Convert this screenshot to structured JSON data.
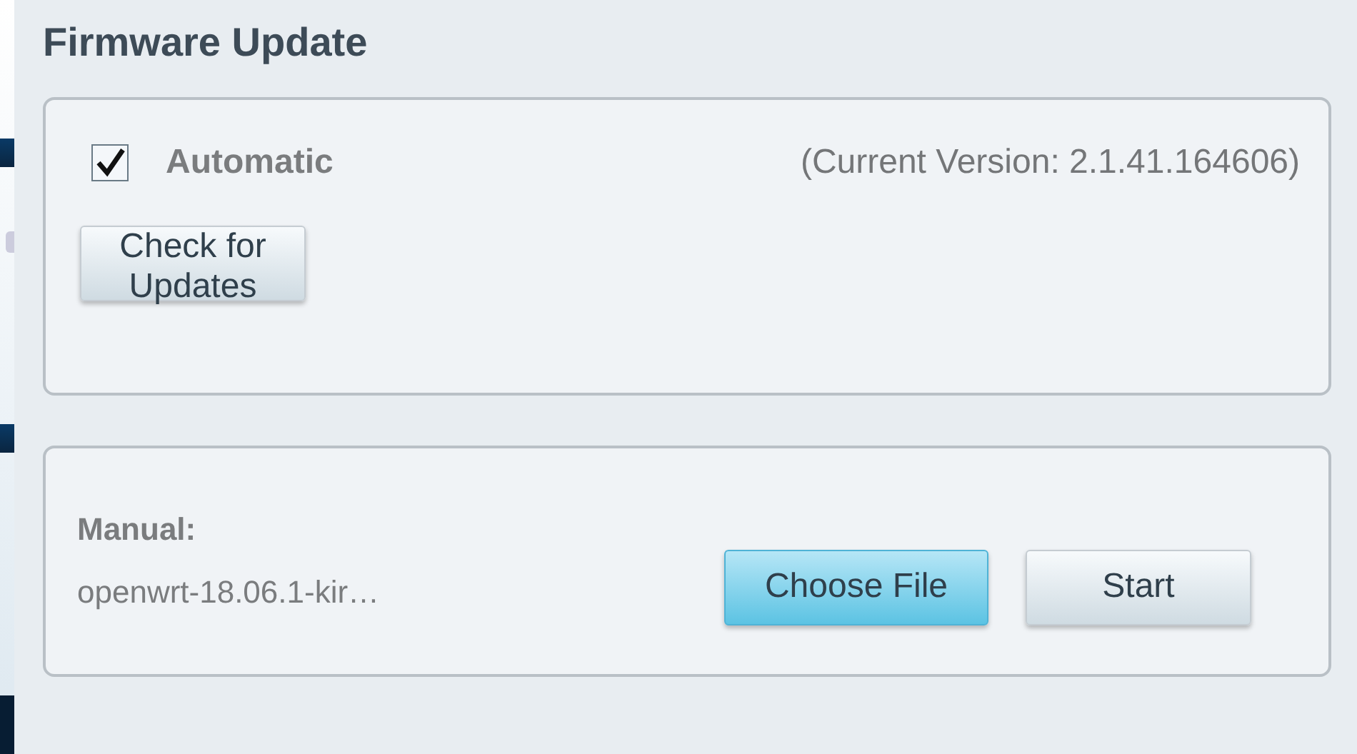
{
  "title": "Firmware Update",
  "automatic": {
    "label": "Automatic",
    "checked": true,
    "current_version": "(Current Version: 2.1.41.164606)",
    "button": "Check for Updates"
  },
  "manual": {
    "label": "Manual:",
    "file_name": "openwrt-18.06.1-kir…",
    "buttons": [
      {
        "label": "Choose File",
        "selected": true
      },
      {
        "label": "Start",
        "selected": false
      }
    ]
  }
}
